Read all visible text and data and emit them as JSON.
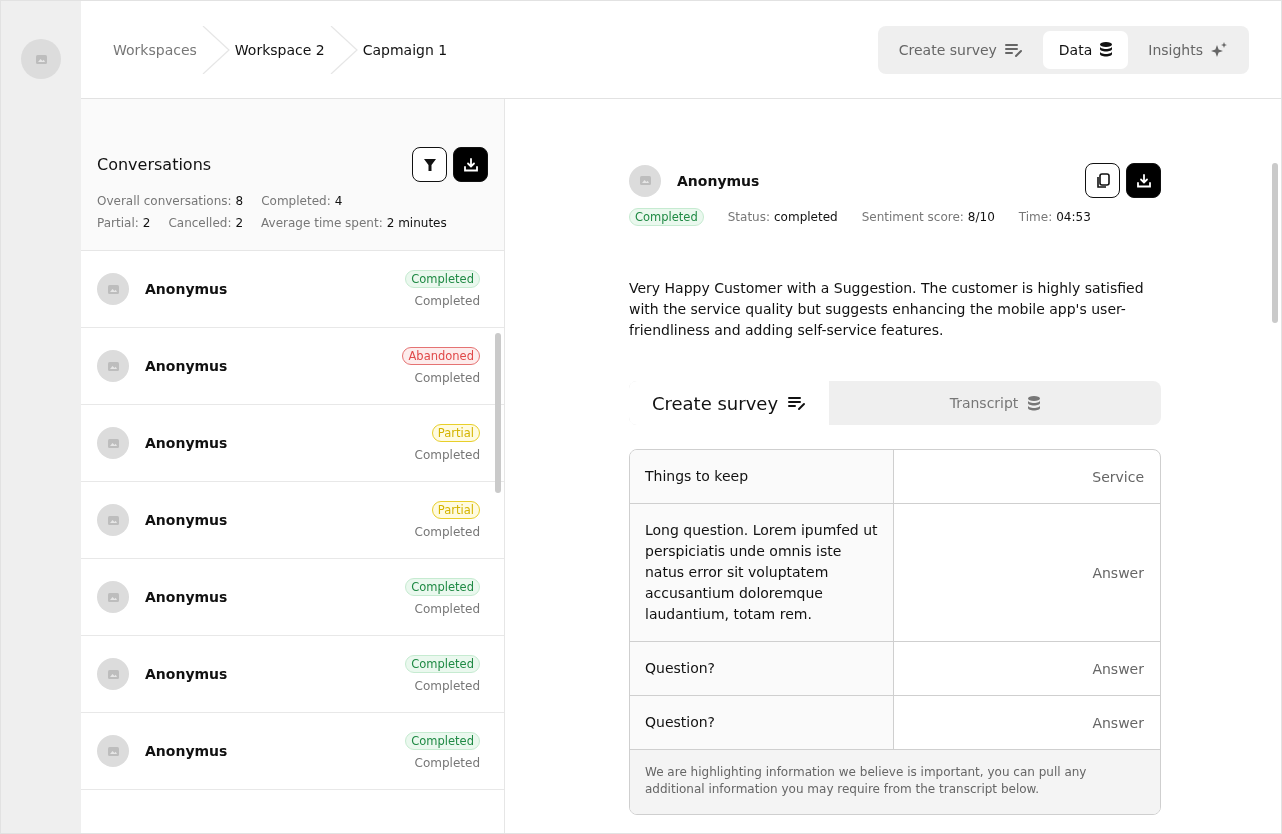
{
  "breadcrumbs": [
    {
      "label": "Workspaces",
      "current": false
    },
    {
      "label": "Workspace 2",
      "current": true
    },
    {
      "label": "Capmaign 1",
      "current": true
    }
  ],
  "view_tabs": [
    {
      "label": "Create survey",
      "kind": "edit",
      "selected": false
    },
    {
      "label": "Data",
      "kind": "data",
      "selected": true
    },
    {
      "label": "Insights",
      "kind": "insights",
      "selected": false
    }
  ],
  "conversations": {
    "title": "Conversations",
    "stats": [
      [
        {
          "label": "Overall conversations:",
          "value": "8"
        },
        {
          "label": "Completed:",
          "value": "4"
        }
      ],
      [
        {
          "label": "Partial:",
          "value": "2"
        },
        {
          "label": "Cancelled:",
          "value": "2"
        },
        {
          "label": "Average time spent:",
          "value": "2 minutes"
        }
      ]
    ],
    "items": [
      {
        "name": "Anonymus",
        "badge": "Completed",
        "kind": "completed",
        "status": "Completed"
      },
      {
        "name": "Anonymus",
        "badge": "Abandoned",
        "kind": "abandoned",
        "status": "Completed"
      },
      {
        "name": "Anonymus",
        "badge": "Partial",
        "kind": "partial",
        "status": "Completed"
      },
      {
        "name": "Anonymus",
        "badge": "Partial",
        "kind": "partial",
        "status": "Completed"
      },
      {
        "name": "Anonymus",
        "badge": "Completed",
        "kind": "completed",
        "status": "Completed"
      },
      {
        "name": "Anonymus",
        "badge": "Completed",
        "kind": "completed",
        "status": "Completed"
      },
      {
        "name": "Anonymus",
        "badge": "Completed",
        "kind": "completed",
        "status": "Completed"
      }
    ]
  },
  "detail": {
    "name": "Anonymus",
    "badge": "Completed",
    "kind": "completed",
    "meta": [
      {
        "label": "Status:",
        "value": "completed"
      },
      {
        "label": "Sentiment score:",
        "value": "8/10"
      },
      {
        "label": "Time:",
        "value": "04:53"
      }
    ],
    "summary": "Very Happy Customer with a Suggestion. The customer is highly satisfied with the service quality but suggests enhancing the mobile app's user-friendliness and adding self-service features.",
    "tabs": [
      {
        "label": "Create survey",
        "kind": "edit",
        "selected": true
      },
      {
        "label": "Transcript",
        "kind": "data",
        "selected": false
      }
    ],
    "rows": [
      {
        "question": "Things to keep",
        "answer": "Service"
      },
      {
        "question": "Long question. Lorem ipumfed ut perspiciatis unde omnis iste natus error sit voluptatem accusantium doloremque laudantium, totam rem.",
        "answer": "Answer"
      },
      {
        "question": "Question?",
        "answer": "Answer"
      },
      {
        "question": "Question?",
        "answer": "Answer"
      }
    ],
    "note": "We are highlighting information we believe is important, you can pull any additional information you may require from the transcript below."
  }
}
